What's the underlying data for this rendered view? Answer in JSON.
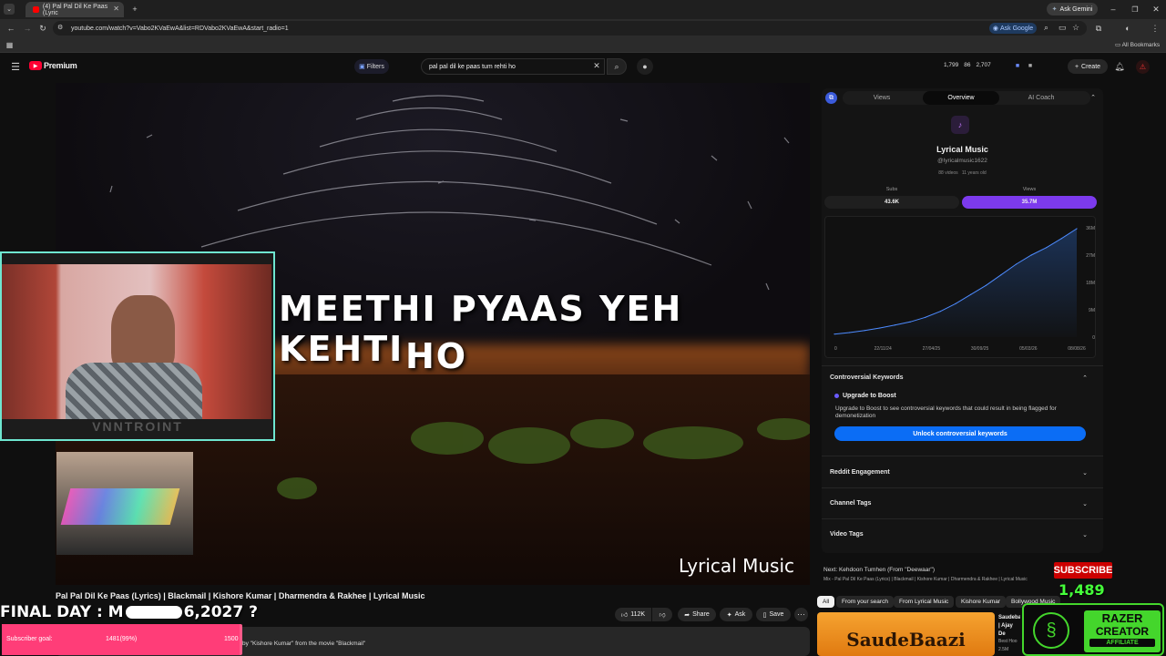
{
  "browser": {
    "tab_title": "(4) Pal Pal Dil Ke Paas (Lyric",
    "url": "youtube.com/watch?v=Vabo2KVaEwA&list=RDVabo2KVaEwA&start_radio=1",
    "ask_gemini": "Ask Gemini",
    "ask_google": "Ask Google",
    "all_bookmarks": "All Bookmarks"
  },
  "youtube": {
    "logo": "Premium",
    "filters": "Filters",
    "search_query": "pal pal dil ke paas tum rehti ho",
    "stats": {
      "a": "1,799",
      "b": "86",
      "c": "2,707"
    },
    "create": "Create"
  },
  "video": {
    "lyric_line1": "MEETHI PYAAS YEH KEHTI",
    "lyric_line2": "HO",
    "watermark": "Lyrical Music",
    "title": "Pal Pal Dil Ke Paas (Lyrics) | Blackmail | Kishore Kumar | Dharmendra & Rakhee | Lyrical Music",
    "likes": "112K",
    "share": "Share",
    "ask": "Ask",
    "save": "Save",
    "description": "by \"Kishore Kumar\" from the movie \"Blackmail\""
  },
  "panel": {
    "tabs": [
      "Views",
      "Overview",
      "AI Coach"
    ],
    "channel_name": "Lyrical Music",
    "handle": "@lyricalmusic1622",
    "videos": "88 videos",
    "age": "11 years old",
    "subs_label": "Subs",
    "subs_value": "43.6K",
    "views_label": "Views",
    "views_value": "35.7M",
    "controversial": "Controversial Keywords",
    "upgrade_title": "Upgrade to Boost",
    "upgrade_text": "Upgrade to Boost to see controversial keywords that could result in being flagged for demonetization",
    "unlock": "Unlock controversial keywords",
    "reddit": "Reddit Engagement",
    "channel_tags": "Channel Tags",
    "video_tags": "Video Tags"
  },
  "chart_data": {
    "type": "area",
    "x_ticks": [
      "22/11/24",
      "27/04/25",
      "30/09/25",
      "05/03/26",
      "08/08/26"
    ],
    "y_ticks": [
      "0",
      "9M",
      "18M",
      "27M",
      "36M"
    ],
    "ylim": [
      0,
      36
    ],
    "x": [
      0,
      1,
      2,
      3,
      4,
      5,
      6,
      7,
      8,
      9,
      10,
      11,
      12,
      13,
      14,
      15,
      16
    ],
    "values": [
      1,
      1.5,
      2.2,
      3,
      4,
      5,
      6.5,
      8.5,
      11,
      14,
      17,
      20.5,
      24,
      27,
      29.5,
      32.5,
      35.7
    ]
  },
  "next": {
    "label": "Next: Kehdoon Tumhen (From \"Deewaar\")",
    "mix": "Mix - Pal Pal Dil Ke Paas (Lyrics) | Blackmail | Kishore Kumar | Dharmendra & Rakhee | Lyrical Music"
  },
  "chips": [
    "All",
    "From your search",
    "From Lyrical Music",
    "Kishore Kumar",
    "Bollywood Music"
  ],
  "rec": {
    "thumb_text": "SaudeBaazi",
    "title": "Saudeba | Ajay De Hindi So",
    "meta": "Best Hoo",
    "views": "2.5M"
  },
  "overlay": {
    "final_day": "FINAL DAY : M",
    "final_day_end": "6,2027 ?",
    "subscriber_goal_label": "Subscriber goal:",
    "goal_progress": "1481(99%)",
    "goal_target": "1500",
    "goal_fraction": 0.987,
    "subscribe": "SUBSCRIBE",
    "sub_count": "1,489",
    "razer_line1": "RAZER",
    "razer_line2": "CREATOR",
    "razer_line3": "AFFILIATE",
    "webcam_text": "VNNTROINT"
  }
}
